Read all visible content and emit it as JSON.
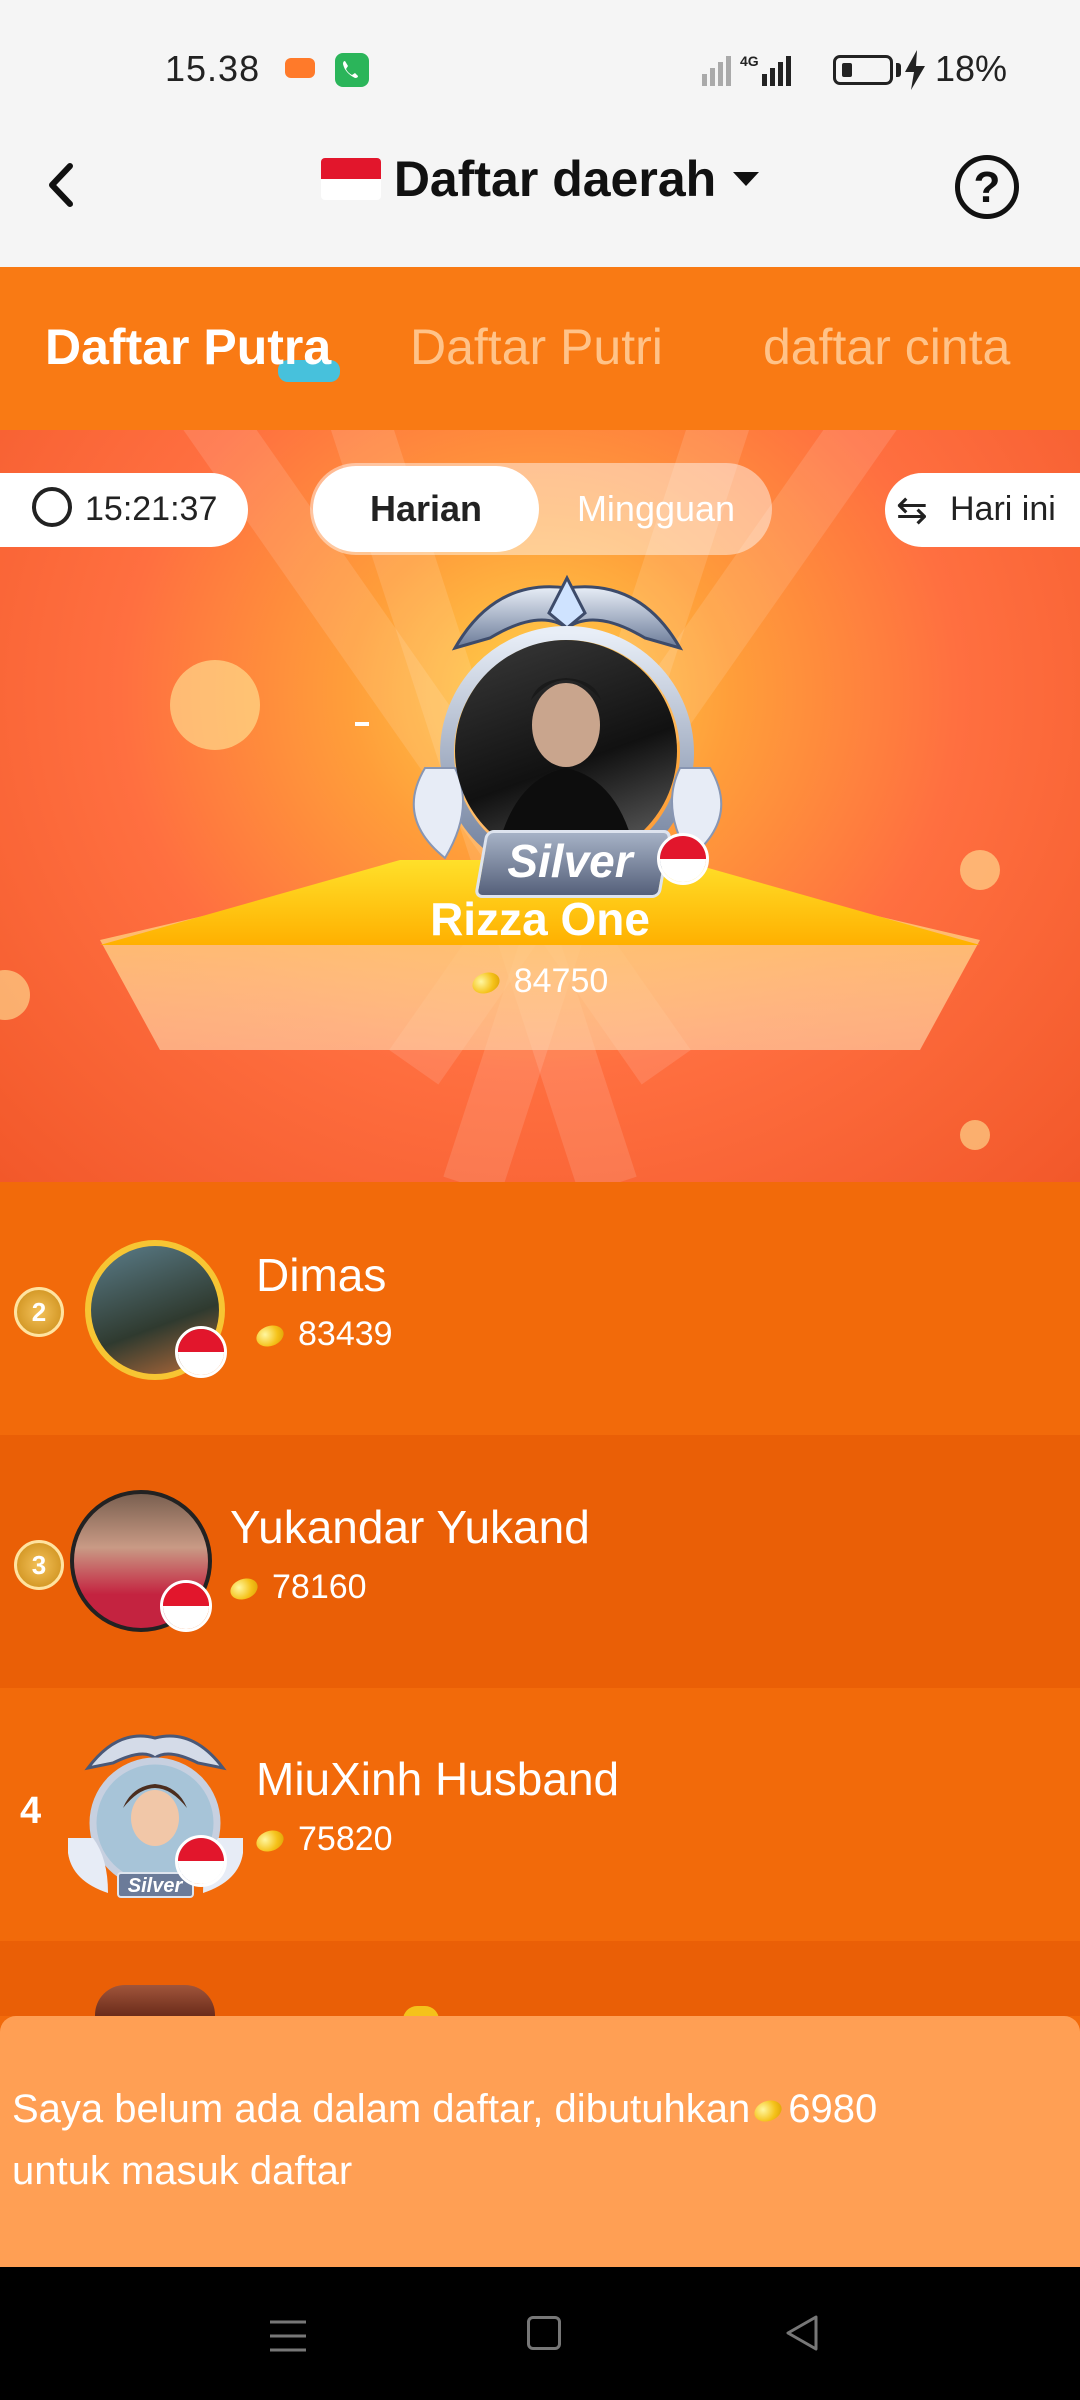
{
  "status_bar": {
    "time": "15.38",
    "battery": "18%",
    "network": "4G"
  },
  "header": {
    "title": "Daftar daerah",
    "back_icon": "chevron-left-icon",
    "help_icon": "question-circle-icon"
  },
  "tabs": [
    {
      "label": "Daftar Putra",
      "active": true
    },
    {
      "label": "Daftar Putri",
      "active": false
    },
    {
      "label": "daftar cinta",
      "active": false
    }
  ],
  "controls": {
    "timer": "15:21:37",
    "period_options": [
      "Harian",
      "Mingguan"
    ],
    "period_selected": "Harian",
    "day_filter": "Hari ini"
  },
  "top_rank": {
    "name": "Rizza One",
    "score": "84750",
    "badge": "Silver",
    "dash": "-"
  },
  "rankings": [
    {
      "rank": "2",
      "name": "Dimas",
      "score": "83439"
    },
    {
      "rank": "3",
      "name": "Yukandar Yukand",
      "score": "78160"
    },
    {
      "rank": "4",
      "name": "MiuXinh Husband",
      "score": "75820",
      "badge": "Silver"
    }
  ],
  "my_status": {
    "text_before": "Saya belum ada dalam daftar, dibutuhkan",
    "amount": "6980",
    "text_after": "untuk masuk daftar"
  },
  "colors": {
    "primary_orange": "#f26a0a",
    "tab_bar": "#f97a14",
    "bottom_panel": "#ff9f54",
    "flag_red": "#e2162c"
  }
}
